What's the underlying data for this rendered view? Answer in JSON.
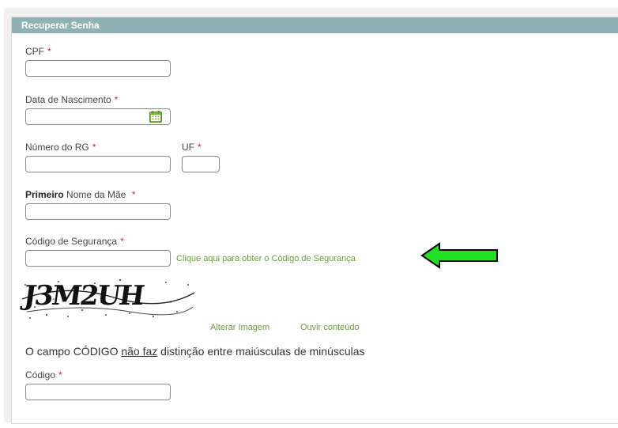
{
  "panel": {
    "title": "Recuperar Senha"
  },
  "fields": {
    "cpf": {
      "label": "CPF",
      "required": "*",
      "value": ""
    },
    "birthdate": {
      "label": "Data de Nascimento",
      "required": "*",
      "value": "",
      "icon": "calendar-icon"
    },
    "rg": {
      "label": "Número do RG",
      "required": "*",
      "value": ""
    },
    "uf": {
      "label": "UF",
      "required": "*",
      "value": ""
    },
    "mother": {
      "label_bold": "Primeiro",
      "label_rest": "Nome da Mãe",
      "required": "*",
      "value": ""
    },
    "security_code": {
      "label": "Código de Segurança",
      "required": "*",
      "value": ""
    },
    "code": {
      "label": "Código",
      "required": "*",
      "value": ""
    }
  },
  "links": {
    "get_security_code": "Clique aqui para obter o Código de Segurança",
    "change_image": "Alterar Imagem",
    "listen_content": "Ouvir conteúdo"
  },
  "captcha": {
    "text": "J3M2UH"
  },
  "note": {
    "before": "O campo CÓDIGO ",
    "underlined": "não faz",
    "after": " distinção entre maiúsculas de minúsculas"
  },
  "colors": {
    "header": "#8fb1b3",
    "link": "#6a9e3a",
    "arrow": "#22e022",
    "required": "#d22222"
  }
}
